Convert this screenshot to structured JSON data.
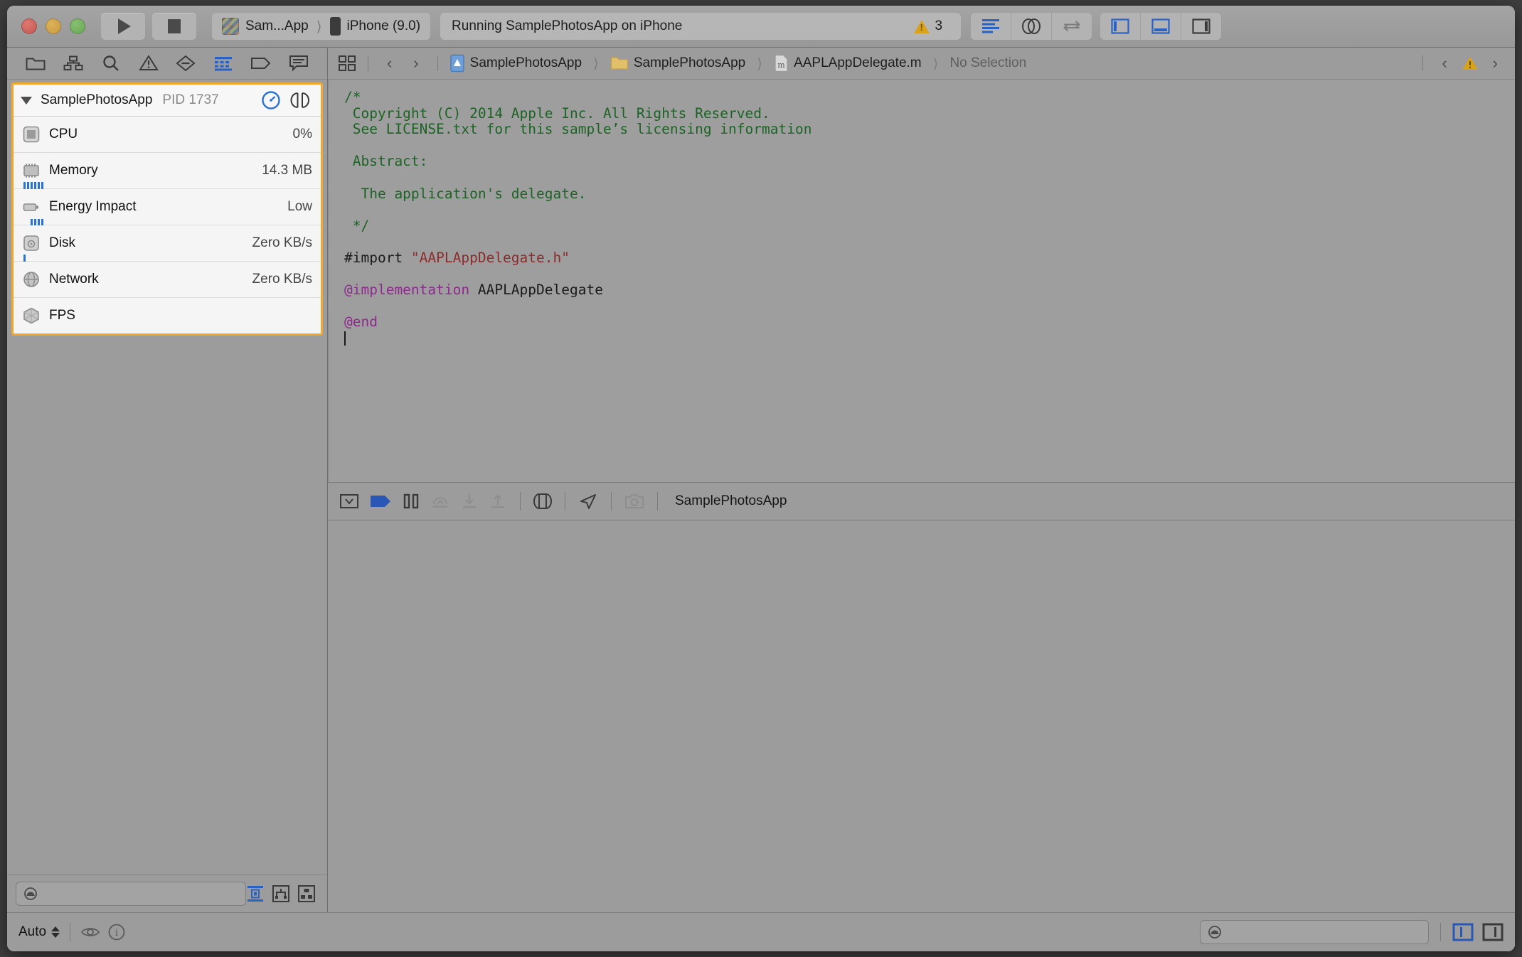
{
  "window": {
    "traffic_lights": [
      "close",
      "minimize",
      "zoom"
    ]
  },
  "toolbar": {
    "run_label": "Run",
    "stop_label": "Stop",
    "scheme_app": "Sam...App",
    "scheme_destination": "iPhone (9.0)",
    "status_text": "Running SamplePhotosApp on iPhone",
    "warning_count": "3",
    "editor_modes": [
      "standard-editor",
      "assistant-editor",
      "version-editor"
    ],
    "view_toggles": [
      "navigator",
      "debug-area",
      "utilities"
    ]
  },
  "navigator": {
    "selector_icons": [
      "project-navigator",
      "symbol-navigator",
      "find-navigator",
      "issue-navigator",
      "test-navigator",
      "debug-navigator",
      "breakpoint-navigator",
      "report-navigator"
    ],
    "selected_icon": "debug-navigator",
    "process": {
      "name": "SamplePhotosApp",
      "pid_label": "PID 1737",
      "header_icons": [
        "gauge-icon",
        "process-view-icon"
      ]
    },
    "gauges": [
      {
        "icon": "cpu-icon",
        "label": "CPU",
        "value": "0%",
        "spark": 0
      },
      {
        "icon": "memory-icon",
        "label": "Memory",
        "value": "14.3 MB",
        "spark": 6
      },
      {
        "icon": "energy-icon",
        "label": "Energy Impact",
        "value": "Low",
        "spark": 4
      },
      {
        "icon": "disk-icon",
        "label": "Disk",
        "value": "Zero KB/s",
        "spark": 1
      },
      {
        "icon": "network-icon",
        "label": "Network",
        "value": "Zero KB/s",
        "spark": 0
      },
      {
        "icon": "fps-icon",
        "label": "FPS",
        "value": "",
        "spark": 0
      }
    ],
    "filter": {
      "placeholder": "",
      "value": "",
      "scope_buttons": [
        "view-process-icon",
        "view-threads-icon",
        "view-queues-icon"
      ]
    },
    "highlight_color": "#f0a830"
  },
  "jumpbar": {
    "related_items_icon": "related-items-icon",
    "back_label": "‹",
    "forward_label": "›",
    "breadcrumbs": [
      {
        "icon": "project-icon",
        "label": "SamplePhotosApp"
      },
      {
        "icon": "folder-icon",
        "label": "SamplePhotosApp"
      },
      {
        "icon": "m-file-icon",
        "label": "AAPLAppDelegate.m"
      },
      {
        "icon": "",
        "label": "No Selection"
      }
    ],
    "issue_nav": [
      "previous-issue",
      "warning-icon",
      "next-issue"
    ]
  },
  "editor": {
    "filename": "AAPLAppDelegate.m",
    "lines": [
      {
        "type": "comment",
        "text": "/*"
      },
      {
        "type": "comment",
        "text": " Copyright (C) 2014 Apple Inc. All Rights Reserved."
      },
      {
        "type": "comment",
        "text": " See LICENSE.txt for this sample’s licensing information"
      },
      {
        "type": "comment",
        "text": " "
      },
      {
        "type": "comment",
        "text": " Abstract:"
      },
      {
        "type": "comment",
        "text": " "
      },
      {
        "type": "comment",
        "text": "  The application's delegate."
      },
      {
        "type": "comment",
        "text": " "
      },
      {
        "type": "comment",
        "text": " */"
      },
      {
        "type": "blank",
        "text": ""
      },
      {
        "type": "import",
        "text": "#import ",
        "string": "\"AAPLAppDelegate.h\""
      },
      {
        "type": "blank",
        "text": ""
      },
      {
        "type": "impl",
        "keyword": "@implementation",
        "text": " AAPLAppDelegate"
      },
      {
        "type": "blank",
        "text": ""
      },
      {
        "type": "end",
        "keyword": "@end",
        "text": ""
      },
      {
        "type": "caret",
        "text": ""
      }
    ]
  },
  "debugbar": {
    "buttons": [
      "hide-debug-area-icon",
      "deactivate-breakpoints-icon",
      "pause-icon",
      "step-over-icon",
      "step-into-icon",
      "step-out-icon",
      "view-debugging-icon",
      "simulate-location-icon",
      "capture-gpu-frame-icon"
    ],
    "process_label": "SamplePhotosApp"
  },
  "statusbar": {
    "auto_label": "Auto",
    "eye_icon": "eye-icon",
    "info_icon": "info-icon",
    "filter": {
      "placeholder": "",
      "value": ""
    },
    "split_toggles": [
      "show-console",
      "show-variables"
    ]
  },
  "colors": {
    "accent_blue": "#2a72d4",
    "highlight_orange": "#f0a830",
    "warning_yellow": "#d9a21b",
    "comment_green": "#1d6325",
    "string_red": "#8c2b2b",
    "keyword_purple": "#8e2a8e"
  }
}
